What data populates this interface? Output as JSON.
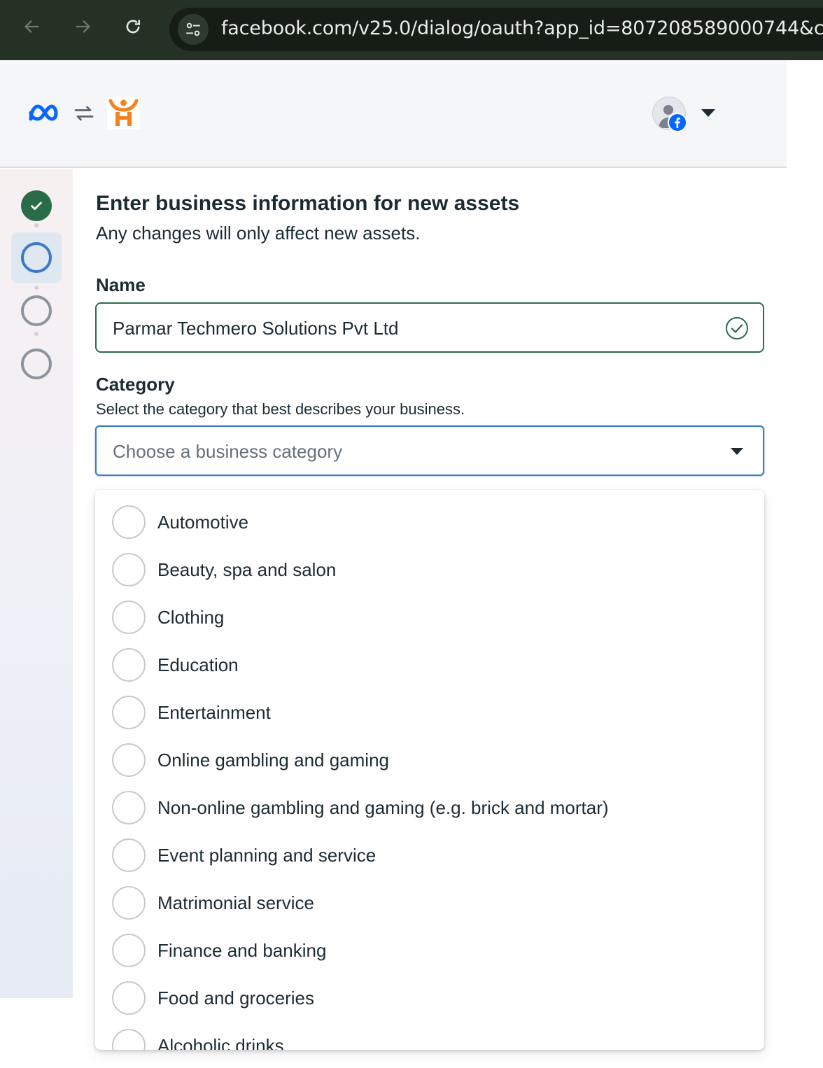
{
  "browser": {
    "url": "facebook.com/v25.0/dialog/oauth?app_id=807208589000744&c",
    "icons": [
      "back-arrow-icon",
      "forward-arrow-icon",
      "reload-icon",
      "site-settings-icon"
    ]
  },
  "header": {
    "icons": [
      "meta-logo-icon",
      "swap-icon",
      "app-logo-icon",
      "avatar",
      "facebook-badge-icon",
      "account-caret-icon"
    ]
  },
  "steps": [
    {
      "status": "completed"
    },
    {
      "status": "active"
    },
    {
      "status": "pending"
    },
    {
      "status": "pending"
    }
  ],
  "form": {
    "title": "Enter business information for new assets",
    "subtitle": "Any changes will only affect new assets.",
    "name_label": "Name",
    "name_value": "Parmar Techmero Solutions Pvt Ltd",
    "category_label": "Category",
    "category_helper": "Select the category that best describes your business.",
    "category_placeholder": "Choose a business category"
  },
  "dropdown": {
    "options": [
      "Automotive",
      "Beauty, spa and salon",
      "Clothing",
      "Education",
      "Entertainment",
      "Online gambling and gaming",
      "Non-online gambling and gaming (e.g. brick and mortar)",
      "Event planning and service",
      "Matrimonial service",
      "Finance and banking",
      "Food and groceries",
      "Alcoholic drinks"
    ]
  },
  "colors": {
    "chrome_bg": "#243124",
    "success_green": "#2a6b4a",
    "focus_blue": "#3b7ac9",
    "meta_blue": "#0866ff",
    "app_orange": "#f58220"
  }
}
